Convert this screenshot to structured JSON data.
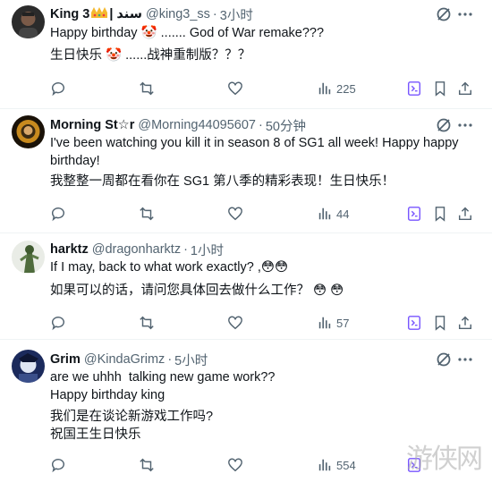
{
  "tweets": [
    {
      "name": "King 3",
      "name_suffix": "| سند",
      "handle": "@king3_ss",
      "time": "3小时",
      "lines": [
        "Happy birthday 🤡 ....... God of War remake???",
        "生日快乐 🤡 ......战神重制版？？？"
      ],
      "views": "225"
    },
    {
      "name": "Morning St☆r",
      "handle": "@Morning44095607",
      "time": "50分钟",
      "lines": [
        "I've been watching you kill it in season 8 of SG1 all week! Happy happy birthday!",
        "我整整一周都在看你在 SG1 第八季的精彩表现！生日快乐！"
      ],
      "views": "44"
    },
    {
      "name": "harktz",
      "handle": "@dragonharktz",
      "time": "1小时",
      "lines": [
        "If I may, back to what work exactly? ,😳😳",
        "如果可以的话，请问您具体回去做什么工作？ 😳 😳"
      ],
      "views": "57"
    },
    {
      "name": "Grim",
      "handle": "@KindaGrimz",
      "time": "5小时",
      "lines": [
        "are we uhhh  talking new game work??\nHappy birthday king",
        "我们是在谈论新游戏工作吗?\n祝国王生日快乐"
      ],
      "views": "554"
    }
  ],
  "watermark": "游侠网",
  "colors": {
    "text": "#0f1419",
    "secondary": "#536471",
    "divider": "#eff3f4",
    "grok": "#7856ff"
  }
}
